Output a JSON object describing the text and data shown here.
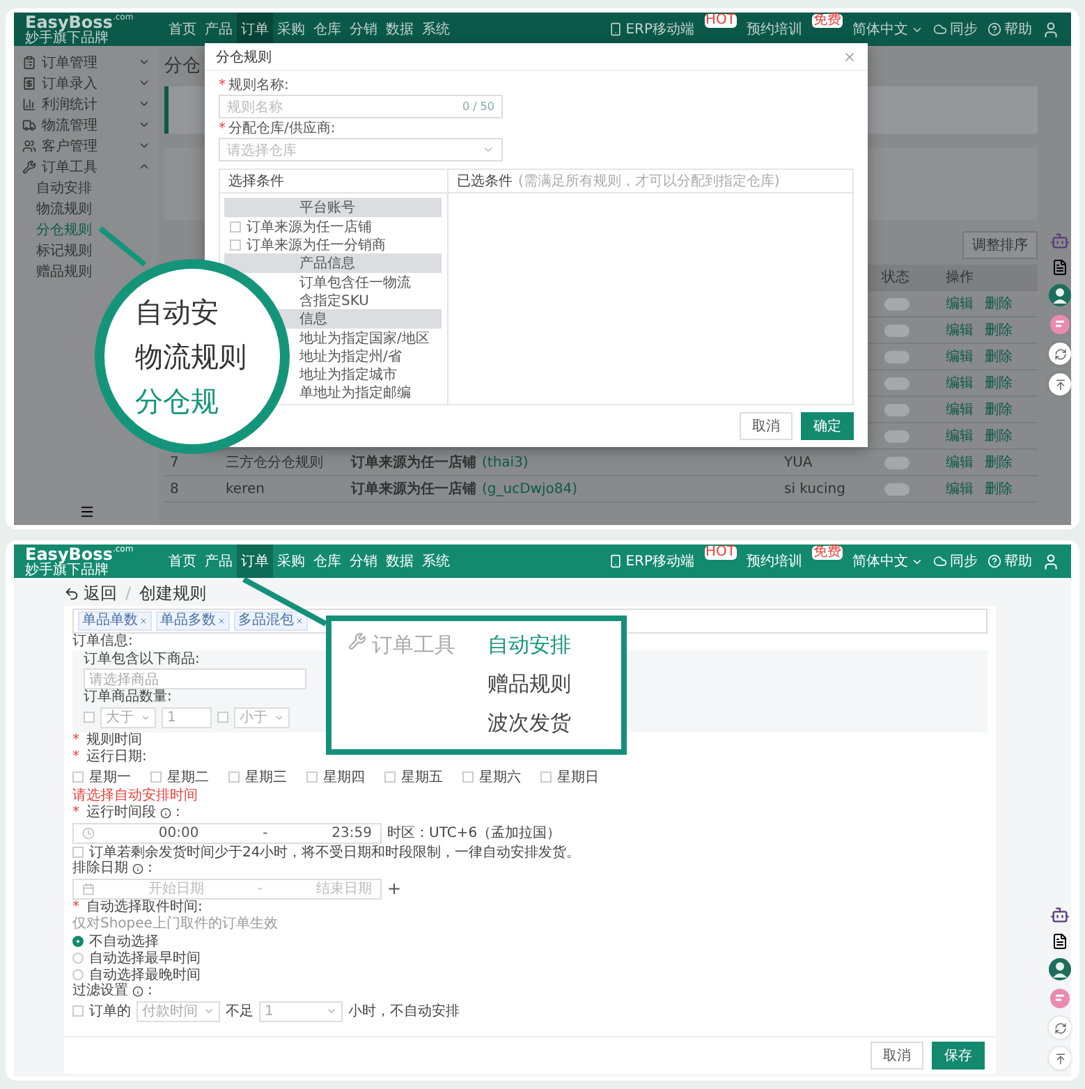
{
  "upper_screen": {
    "header": {
      "logo": {
        "name": "EasyBoss",
        "domain": ".com",
        "tagline": "妙手旗下品牌"
      },
      "nav": [
        {
          "label": "首页",
          "selected": false
        },
        {
          "label": "产品",
          "selected": false
        },
        {
          "label": "订单",
          "selected": true
        },
        {
          "label": "采购",
          "selected": false
        },
        {
          "label": "仓库",
          "selected": false
        },
        {
          "label": "分销",
          "selected": false
        },
        {
          "label": "数据",
          "selected": false
        },
        {
          "label": "系统",
          "selected": false
        }
      ],
      "links": [
        {
          "kind": "mobile",
          "label": "ERP移动端",
          "badge": "HOT"
        },
        {
          "kind": "training",
          "label": "预约培训",
          "badge": "免费"
        },
        {
          "kind": "language",
          "label": "简体中文"
        },
        {
          "kind": "sync",
          "label": "同步"
        },
        {
          "kind": "help",
          "label": "帮助"
        }
      ]
    },
    "sidebar": [
      {
        "label": "订单管理",
        "expanded": false
      },
      {
        "label": "订单录入",
        "expanded": false
      },
      {
        "label": "利润统计",
        "expanded": false
      },
      {
        "label": "物流管理",
        "expanded": false
      },
      {
        "label": "客户管理",
        "expanded": false
      },
      {
        "label": "订单工具",
        "expanded": true,
        "children": [
          {
            "label": "自动安排",
            "selected": false
          },
          {
            "label": "物流规则",
            "selected": false
          },
          {
            "label": "分仓规则",
            "selected": true
          },
          {
            "label": "标记规则",
            "selected": false
          },
          {
            "label": "赠品规则",
            "selected": false
          }
        ]
      }
    ],
    "page_title": "分仓",
    "sort_button": "调整排序",
    "table": {
      "columns": [
        {
          "label": "状态"
        },
        {
          "label": "操作"
        }
      ],
      "rows": [
        {
          "on": false,
          "actions": [
            "编辑",
            "删除"
          ]
        },
        {
          "on": false,
          "actions": [
            "编辑",
            "删除"
          ]
        },
        {
          "on": false,
          "actions": [
            "编辑",
            "删除"
          ]
        },
        {
          "on": false,
          "actions": [
            "编辑",
            "删除"
          ]
        },
        {
          "on": false,
          "actions": [
            "编辑",
            "删除"
          ]
        },
        {
          "on": false,
          "actions": [
            "编辑",
            "删除"
          ]
        },
        {
          "index": "7",
          "name": "三方仓分仓规则",
          "condition": "订单来源为任一店铺",
          "condition_value": "(thai3)",
          "column_4": "YUA",
          "on": false,
          "actions": [
            "编辑",
            "删除"
          ]
        },
        {
          "index": "8",
          "name": "keren",
          "condition": "订单来源为任一店铺",
          "condition_value": "(g_ucDwjo84)",
          "column_4": "si kucing",
          "on": false,
          "actions": [
            "编辑",
            "删除"
          ]
        }
      ]
    },
    "modal": {
      "title": "分仓规则",
      "fields": [
        {
          "kind": "text",
          "marker": "*",
          "label": "规则名称:",
          "placeholder": "规则名称",
          "counter": "0 / 50"
        },
        {
          "kind": "select",
          "marker": "*",
          "label": "分配仓库/供应商:",
          "placeholder": "请选择仓库"
        }
      ],
      "conditions_header": "选择条件",
      "selected_header": "已选条件",
      "selected_hint": "(需满足所有规则，才可以分配到指定仓库)",
      "groups": [
        {
          "label": "平台账号",
          "items": [
            {
              "kind": "checkbox",
              "label": "订单来源为任一店铺",
              "checked": false
            },
            {
              "kind": "checkbox",
              "label": "订单来源为任一分销商",
              "checked": false
            }
          ]
        },
        {
          "label": "产品信息",
          "items": [
            {
              "kind": "text",
              "label": "订单包含任一物流"
            },
            {
              "kind": "text",
              "label": "含指定SKU"
            }
          ]
        },
        {
          "label": "信息",
          "items": [
            {
              "kind": "text",
              "label": "地址为指定国家/地区"
            },
            {
              "kind": "text",
              "label": "地址为指定州/省"
            },
            {
              "kind": "text",
              "label": "地址为指定城市"
            },
            {
              "kind": "text",
              "label": "单地址为指定邮编"
            }
          ]
        }
      ],
      "buttons": [
        {
          "kind": "secondary",
          "label": "取消"
        },
        {
          "kind": "primary",
          "label": "确定"
        }
      ]
    },
    "magnifier": {
      "items": [
        {
          "label": "自动安",
          "selected": false
        },
        {
          "label": "物流规则",
          "selected": false
        },
        {
          "label": "分仓规",
          "selected": true
        }
      ]
    }
  },
  "lower_screen": {
    "header": {
      "logo": {
        "name": "EasyBoss",
        "domain": ".com",
        "tagline": "妙手旗下品牌"
      },
      "nav": [
        {
          "label": "首页",
          "selected": false
        },
        {
          "label": "产品",
          "selected": false
        },
        {
          "label": "订单",
          "selected": true
        },
        {
          "label": "采购",
          "selected": false
        },
        {
          "label": "仓库",
          "selected": false
        },
        {
          "label": "分销",
          "selected": false
        },
        {
          "label": "数据",
          "selected": false
        },
        {
          "label": "系统",
          "selected": false
        }
      ],
      "links": [
        {
          "kind": "mobile",
          "label": "ERP移动端",
          "badge": "HOT"
        },
        {
          "kind": "training",
          "label": "预约培训",
          "badge": "免费"
        },
        {
          "kind": "language",
          "label": "简体中文"
        },
        {
          "kind": "sync",
          "label": "同步"
        },
        {
          "kind": "help",
          "label": "帮助"
        }
      ]
    },
    "breadcrumb": {
      "back": "返回",
      "separator": "/",
      "current": "创建规则"
    },
    "tags": [
      "单品单数",
      "单品多数",
      "多品混包"
    ],
    "order_info": {
      "label": "订单信息:",
      "products_label": "订单包含以下商品:",
      "products_placeholder": "请选择商品",
      "quantity_label": "订单商品数量:",
      "quantity": [
        {
          "operator": "大于",
          "value": "1",
          "checked": false
        },
        {
          "operator": "小于",
          "checked": false
        }
      ]
    },
    "rule_time": {
      "marker": "*",
      "label": "规则时间"
    },
    "run_days": {
      "marker": "*",
      "label": "运行日期:",
      "days": [
        {
          "label": "星期一",
          "checked": false
        },
        {
          "label": "星期二",
          "checked": false
        },
        {
          "label": "星期三",
          "checked": false
        },
        {
          "label": "星期四",
          "checked": false
        },
        {
          "label": "星期五",
          "checked": false
        },
        {
          "label": "星期六",
          "checked": false
        },
        {
          "label": "星期日",
          "checked": false
        }
      ],
      "error": "请选择自动安排时间"
    },
    "run_period": {
      "marker": "*",
      "label": "运行时间段",
      "suffix": ":",
      "start": "00:00",
      "separator": "-",
      "end": "23:59",
      "timezone": "时区：UTC+6（孟加拉国）"
    },
    "urgent": {
      "label": "订单若剩余发货时间少于24小时，将不受日期和时段限制，一律自动安排发货。",
      "checked": false
    },
    "exclude_dates": {
      "label": "排除日期",
      "suffix": ":",
      "start_placeholder": "开始日期",
      "separator": "-",
      "end_placeholder": "结束日期",
      "add": "+"
    },
    "pickup": {
      "marker": "*",
      "label": "自动选择取件时间:",
      "hint": "仅对Shopee上门取件的订单生效",
      "options": [
        {
          "label": "不自动选择",
          "selected": true
        },
        {
          "label": "自动选择最早时间",
          "selected": false
        },
        {
          "label": "自动选择最晚时间",
          "selected": false
        }
      ]
    },
    "filter": {
      "label": "过滤设置",
      "suffix": ":",
      "checked": false,
      "prefix": "订单的",
      "field": "付款时间",
      "middle": "不足",
      "amount": "1",
      "unit": "小时，不自动安排"
    },
    "buttons": [
      {
        "kind": "secondary",
        "label": "取消"
      },
      {
        "kind": "primary",
        "label": "保存"
      }
    ],
    "callout": {
      "title": "订单工具",
      "items": [
        {
          "label": "自动安排",
          "selected": true
        },
        {
          "label": "赠品规则",
          "selected": false
        },
        {
          "label": "波次发货",
          "selected": false
        }
      ]
    }
  }
}
